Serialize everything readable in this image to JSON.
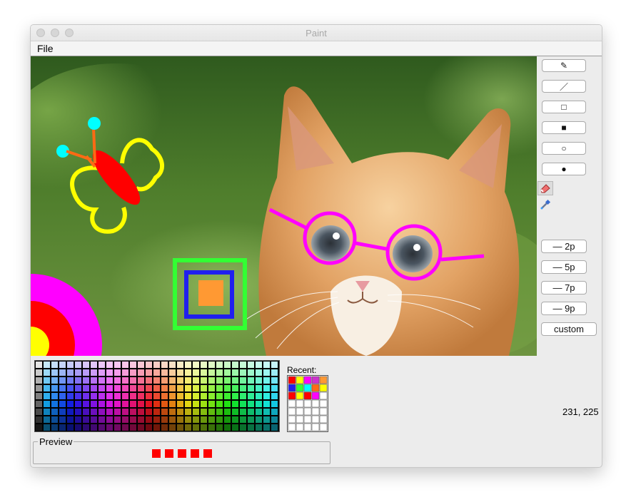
{
  "window": {
    "title": "Paint"
  },
  "menu": {
    "file": "File"
  },
  "tools": [
    {
      "name": "pencil-tool",
      "glyph": "✎"
    },
    {
      "name": "line-tool",
      "glyph": "／"
    },
    {
      "name": "rectangle-tool",
      "glyph": "□"
    },
    {
      "name": "filled-rectangle-tool",
      "glyph": "■"
    },
    {
      "name": "oval-tool",
      "glyph": "○"
    },
    {
      "name": "filled-oval-tool",
      "glyph": "●"
    }
  ],
  "tool_icons": [
    "eraser-icon",
    "eyedropper-icon"
  ],
  "widths": [
    {
      "label": "— 2p"
    },
    {
      "label": "— 5p"
    },
    {
      "label": "— 7p"
    },
    {
      "label": "— 9p"
    }
  ],
  "custom_label": "custom",
  "recent": {
    "label": "Recent:"
  },
  "preview": {
    "label": "Preview"
  },
  "status": {
    "coords": "231, 225"
  },
  "colors": {
    "accent_magenta": "#ff00ff",
    "preview_red": "#ff0000"
  }
}
